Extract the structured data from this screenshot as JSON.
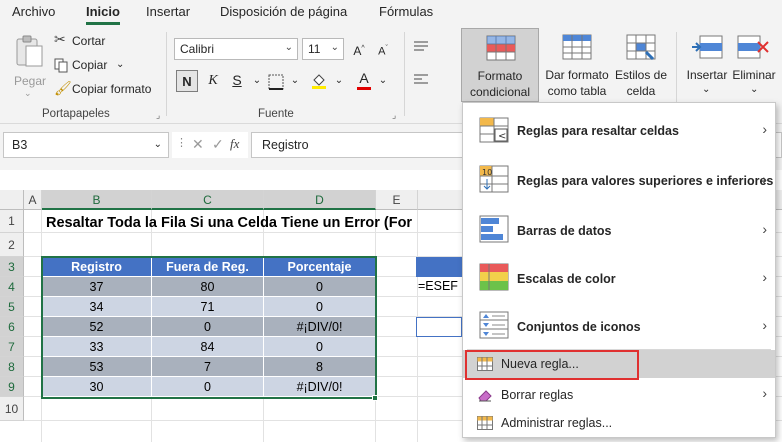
{
  "menu": {
    "tabs": [
      {
        "label": "Archivo"
      },
      {
        "label": "Inicio"
      },
      {
        "label": "Insertar"
      },
      {
        "label": "Disposición de página"
      },
      {
        "label": "Fórmulas"
      }
    ]
  },
  "ribbon": {
    "clipboard": {
      "paste": "Pegar",
      "cut": "Cortar",
      "copy": "Copiar",
      "copy_format": "Copiar formato",
      "group": "Portapapeles"
    },
    "font": {
      "name": "Calibri",
      "size": "11",
      "bold": "N",
      "group": "Fuente"
    },
    "styles": {
      "cond_line1": "Formato",
      "cond_line2": "condicional",
      "table_line1": "Dar formato",
      "table_line2": "como tabla",
      "cell_line1": "Estilos de",
      "cell_line2": "celda"
    },
    "cells": {
      "insert": "Insertar",
      "delete": "Eliminar"
    }
  },
  "formula_bar": {
    "name_box": "B3",
    "fx": "fx",
    "content": "Registro"
  },
  "grid": {
    "columns": [
      "A",
      "B",
      "C",
      "D",
      "E"
    ],
    "rows": [
      "1",
      "2",
      "3",
      "4",
      "5",
      "6",
      "7",
      "8",
      "9",
      "10"
    ],
    "title": "Resaltar Toda la Fila Si una Celda Tiene un Error (For",
    "e4_text": "=ESEF"
  },
  "table": {
    "headers": [
      "Registro",
      "Fuera de Reg.",
      "Porcentaje"
    ],
    "rows": [
      [
        "37",
        "80",
        "0"
      ],
      [
        "34",
        "71",
        "0"
      ],
      [
        "52",
        "0",
        "#¡DIV/0!"
      ],
      [
        "33",
        "84",
        "0"
      ],
      [
        "53",
        "7",
        "8"
      ],
      [
        "30",
        "0",
        "#¡DIV/0!"
      ]
    ]
  },
  "dropdown": {
    "highlight_rules": "Reglas para resaltar celdas",
    "top_bottom_rules": "Reglas para valores superiores e inferiores",
    "data_bars": "Barras de datos",
    "color_scales": "Escalas de color",
    "icon_sets": "Conjuntos de iconos",
    "new_rule": "Nueva regla...",
    "clear_rules": "Borrar reglas",
    "manage_rules": "Administrar reglas..."
  },
  "colors": {
    "accent": "#217346",
    "table_header": "#4472c4",
    "row_light": "#cdd5e3",
    "row_dark": "#a9b1bd",
    "highlight_border": "#e03030"
  }
}
